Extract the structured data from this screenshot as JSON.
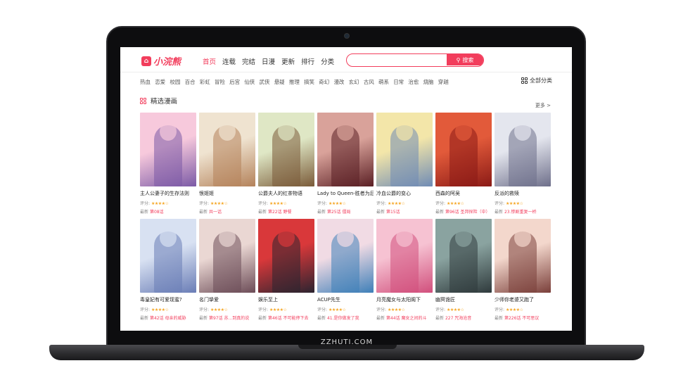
{
  "brand_caption": "ZZHUTI.COM",
  "header": {
    "logo_text": "小浣熊",
    "nav": [
      "首页",
      "连载",
      "完结",
      "日漫",
      "更新",
      "排行",
      "分类"
    ],
    "search_placeholder": "",
    "search_button": "搜索",
    "accent": "#f23d5c"
  },
  "categories": [
    "热血",
    "恋爱",
    "校园",
    "百合",
    "彩虹",
    "冒险",
    "后宫",
    "仙侠",
    "武侠",
    "悬疑",
    "推理",
    "搞笑",
    "奇幻",
    "漫改",
    "玄幻",
    "古风",
    "萌系",
    "日常",
    "治愈",
    "烧脑",
    "穿越"
  ],
  "all_categories": "全部分类",
  "section": {
    "title": "精选漫画",
    "more": "更多 >"
  },
  "rating_label": "评分:",
  "latest_label": "最新",
  "comics": [
    {
      "title": "主人公妻子的生存法则",
      "stars": "★★★★☆",
      "chapter": "第08话",
      "c1": "#f7c9dc",
      "c2": "#7b5aa6"
    },
    {
      "title": "恨姬姬",
      "stars": "★★★★☆",
      "chapter": "共一话",
      "c1": "#efe3d0",
      "c2": "#b4825a"
    },
    {
      "title": "公爵夫人的红茶物语",
      "stars": "★★★★☆",
      "chapter": "第22话 野餐",
      "c1": "#dfe7c5",
      "c2": "#7a5a38"
    },
    {
      "title": "Lady to Queen-胜者为后",
      "stars": "★★★★☆",
      "chapter": "第25话 僵局",
      "c1": "#d9a29a",
      "c2": "#5a1f24"
    },
    {
      "title": "冷血公爵的变心",
      "stars": "★★★★☆",
      "chapter": "第15话",
      "c1": "#f3e6a9",
      "c2": "#6f8bb5"
    },
    {
      "title": "西森的阿吴",
      "stars": "★★★★☆",
      "chapter": "第96话 圣邦探险（中）",
      "c1": "#e25a3a",
      "c2": "#8a1a16"
    },
    {
      "title": "反派的救赎",
      "stars": "★★★★☆",
      "chapter": "23.惨剧重复一桥",
      "c1": "#e4e6ee",
      "c2": "#6e6f8a"
    },
    {
      "title": "毒皇妃有可爱现蜜?",
      "stars": "★★★★☆",
      "chapter": "第42话 母亲的威胁",
      "c1": "#d8e1f2",
      "c2": "#6a7db6"
    },
    {
      "title": "名门挚爱",
      "stars": "★★★★☆",
      "chapter": "第97话 苏...到真的说",
      "c1": "#ead7d3",
      "c2": "#6c4c57"
    },
    {
      "title": "娱乐至上",
      "stars": "★★★★☆",
      "chapter": "第46话 不可能停下去",
      "c1": "#d9383a",
      "c2": "#2b2430"
    },
    {
      "title": "ACUP先生",
      "stars": "★★★★☆",
      "chapter": "41.是你做发了我",
      "c1": "#f1dbe4",
      "c2": "#3e7fb8"
    },
    {
      "title": "月亮魔女与太阳阁下",
      "stars": "★★★★☆",
      "chapter": "第44话 魔女之间的斗",
      "c1": "#f6c2d2",
      "c2": "#d14f7c"
    },
    {
      "title": "幽冥诡匠",
      "stars": "★★★★☆",
      "chapter": "227 咒海沧音",
      "c1": "#8aa3a0",
      "c2": "#2f3a3c"
    },
    {
      "title": "少师你老婆又跑了",
      "stars": "★★★★☆",
      "chapter": "第226话 不可思议",
      "c1": "#f3d7cc",
      "c2": "#7a3f3a"
    }
  ]
}
